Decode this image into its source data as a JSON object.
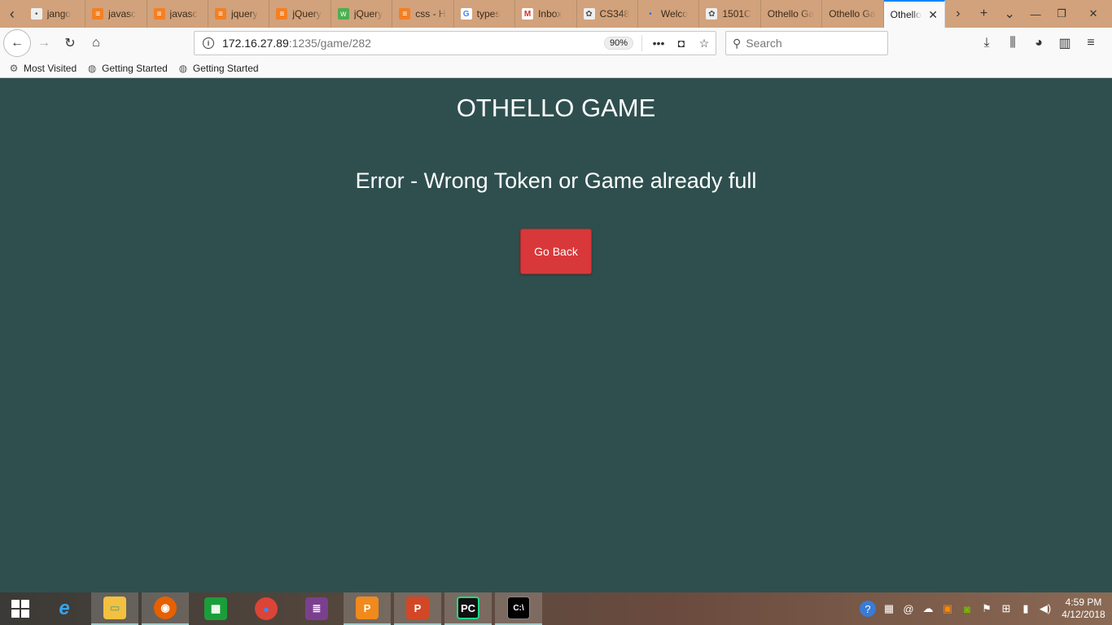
{
  "browser": {
    "tabs": [
      {
        "title": "jango",
        "icon": "page-icon"
      },
      {
        "title": "javasc",
        "icon": "stackoverflow-icon"
      },
      {
        "title": "javasc",
        "icon": "stackoverflow-icon"
      },
      {
        "title": "jquery",
        "icon": "stackoverflow-icon"
      },
      {
        "title": "jQuery",
        "icon": "stackoverflow-icon"
      },
      {
        "title": "jQuery",
        "icon": "w3schools-icon"
      },
      {
        "title": "css - H",
        "icon": "stackoverflow-icon"
      },
      {
        "title": "types",
        "icon": "google-icon"
      },
      {
        "title": "Inbox",
        "icon": "gmail-icon"
      },
      {
        "title": "CS348",
        "icon": "university-seal-icon"
      },
      {
        "title": "Welco",
        "icon": "dot-icon"
      },
      {
        "title": "1501C",
        "icon": "university-seal-icon"
      },
      {
        "title": "Othello Ga",
        "icon": "none"
      },
      {
        "title": "Othello Ga",
        "icon": "none"
      },
      {
        "title": "Othello",
        "icon": "none",
        "active": true
      }
    ],
    "url": {
      "host": "172.16.27.89",
      "path": ":1235/game/282",
      "zoom": "90%"
    },
    "search": {
      "placeholder": "Search"
    },
    "bookmarks": [
      {
        "label": "Most Visited",
        "icon": "gear-icon"
      },
      {
        "label": "Getting Started",
        "icon": "globe-icon"
      },
      {
        "label": "Getting Started",
        "icon": "globe-icon"
      }
    ]
  },
  "page": {
    "title": "OTHELLO GAME",
    "error": "Error - Wrong Token or Game already full",
    "button": "Go Back",
    "background": "#2f4f4f",
    "button_color": "#d9383a"
  },
  "taskbar": {
    "apps": [
      "windows-start-icon",
      "internet-explorer-icon",
      "file-explorer-icon",
      "firefox-icon",
      "store-icon",
      "chrome-icon",
      "winrar-icon",
      "foxit-pdf-icon",
      "powerpoint-icon",
      "pycharm-icon",
      "command-prompt-icon"
    ],
    "clock": {
      "time": "4:59 PM",
      "date": "4/12/2018"
    }
  }
}
